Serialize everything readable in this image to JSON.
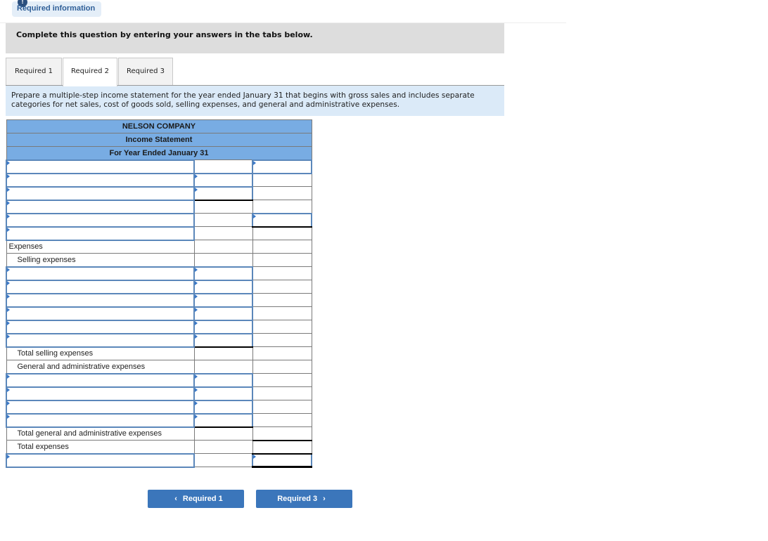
{
  "banner": {
    "icon": "alert-icon",
    "icon_glyph": "!",
    "label": "Required information"
  },
  "instruction": "Complete this question by entering your answers in the tabs below.",
  "tabs": [
    {
      "label": "Required 1",
      "active": false
    },
    {
      "label": "Required 2",
      "active": true
    },
    {
      "label": "Required 3",
      "active": false
    }
  ],
  "prompt": "Prepare a multiple-step income statement for the year ended January 31 that begins with gross sales and includes separate categories for net sales, cost of goods sold, selling expenses, and general and administrative expenses.",
  "statement": {
    "company": "NELSON COMPANY",
    "title": "Income Statement",
    "period": "For Year Ended January 31",
    "rows": [
      {
        "label": "",
        "c1": "input",
        "c2": "empty",
        "c3": "input"
      },
      {
        "label": "",
        "c1": "input",
        "c2": "input",
        "c3": "empty"
      },
      {
        "label": "",
        "c1": "input",
        "c2": "input",
        "c3": "empty"
      },
      {
        "label": "",
        "c1": "input",
        "c2": "empty",
        "c3": "empty"
      },
      {
        "label": "",
        "c1": "input",
        "c2": "empty",
        "c3": "input"
      },
      {
        "label": "",
        "c1": "input",
        "c2": "empty",
        "c3": "empty"
      },
      {
        "label": "Expenses",
        "c1": "text",
        "c2": "empty",
        "c3": "empty"
      },
      {
        "label": "Selling expenses",
        "c1": "text",
        "c2": "empty",
        "c3": "empty"
      },
      {
        "label": "",
        "c1": "input",
        "c2": "input",
        "c3": "empty"
      },
      {
        "label": "",
        "c1": "input",
        "c2": "input",
        "c3": "empty"
      },
      {
        "label": "",
        "c1": "input",
        "c2": "input",
        "c3": "empty"
      },
      {
        "label": "",
        "c1": "input",
        "c2": "input",
        "c3": "empty"
      },
      {
        "label": "",
        "c1": "input",
        "c2": "input",
        "c3": "empty"
      },
      {
        "label": "",
        "c1": "input",
        "c2": "input",
        "c3": "empty"
      },
      {
        "label": "Total selling expenses",
        "c1": "text",
        "c2": "empty",
        "c3": "empty"
      },
      {
        "label": "General and administrative expenses",
        "c1": "text",
        "c2": "empty",
        "c3": "empty"
      },
      {
        "label": "",
        "c1": "input",
        "c2": "input",
        "c3": "empty"
      },
      {
        "label": "",
        "c1": "input",
        "c2": "input",
        "c3": "empty"
      },
      {
        "label": "",
        "c1": "input",
        "c2": "input",
        "c3": "empty"
      },
      {
        "label": "",
        "c1": "input",
        "c2": "input",
        "c3": "empty"
      },
      {
        "label": "Total general and administrative expenses",
        "c1": "text",
        "c2": "empty",
        "c3": "empty"
      },
      {
        "label": "Total expenses",
        "c1": "text",
        "c2": "empty",
        "c3": "empty"
      },
      {
        "label": "",
        "c1": "input",
        "c2": "empty",
        "c3": "input"
      }
    ]
  },
  "nav": {
    "prev_label": "Required 1",
    "prev_icon": "chevron-left-icon",
    "next_label": "Required 3",
    "next_icon": "chevron-right-icon"
  }
}
